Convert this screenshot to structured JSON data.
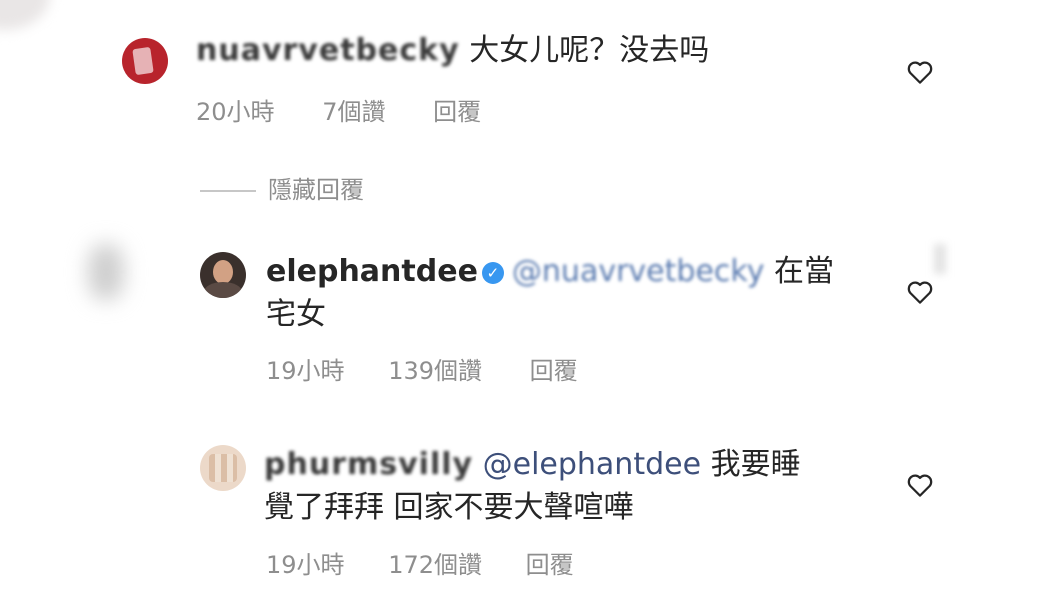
{
  "comments": [
    {
      "username": "nuavrvetbecky",
      "text": "大女儿呢？没去吗",
      "time": "20小時",
      "likes": "7個讚",
      "reply": "回覆"
    },
    {
      "username": "elephantdee",
      "mention": "@nuavrvetbecky",
      "text_line1": "在當",
      "text_line2": "宅女",
      "time": "19小時",
      "likes": "139個讚",
      "reply": "回覆"
    },
    {
      "username": "phurmsvilly",
      "mention": "@elephantdee",
      "text_line1": "我要睡",
      "text_line2": "覺了拜拜 回家不要大聲喧嘩",
      "time": "19小時",
      "likes": "172個讚",
      "reply": "回覆"
    }
  ],
  "hidden_replies_label": "隱藏回覆",
  "icons": {
    "like": "heart-outline-icon",
    "verified": "verified-badge-icon"
  },
  "colors": {
    "text": "#262626",
    "meta": "#8e8e8e",
    "verified": "#3897f0",
    "mention": "#3d4f7a"
  }
}
